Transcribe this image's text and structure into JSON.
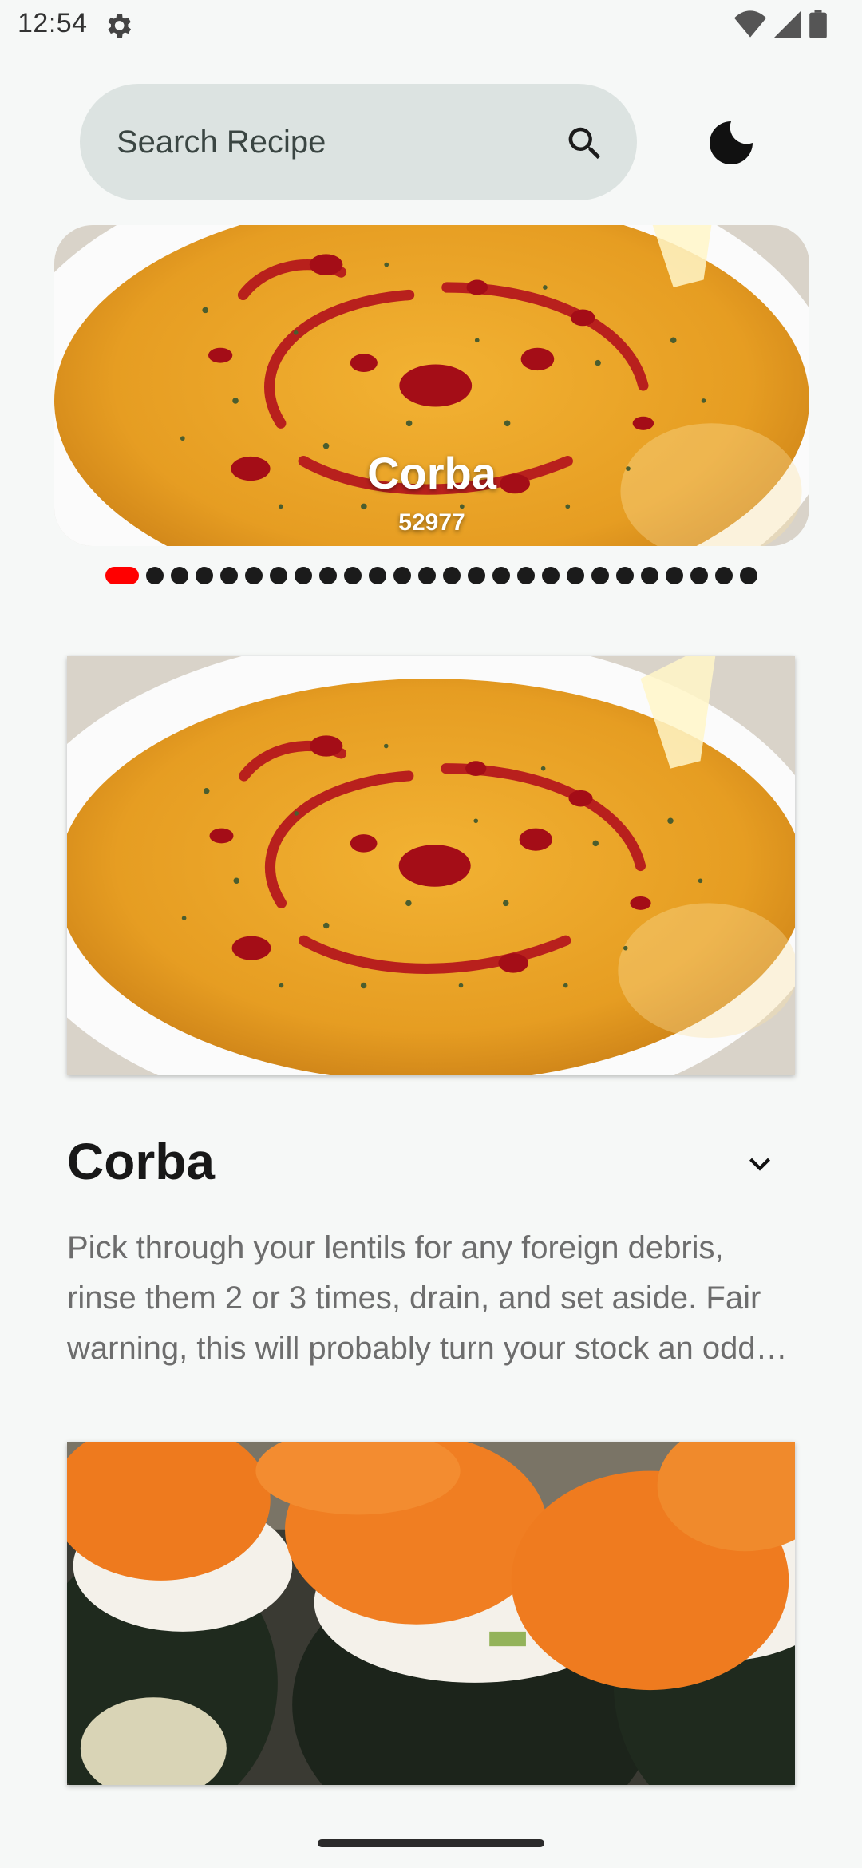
{
  "status": {
    "time": "12:54"
  },
  "search": {
    "placeholder": "Search Recipe"
  },
  "carousel": {
    "title": "Corba",
    "id": "52977",
    "dot_count": 26,
    "active_index": 0
  },
  "recipes": [
    {
      "title": "Corba",
      "description": "Pick through your lentils for any foreign debris, rinse them 2 or 3 times, drain, and set aside.  Fair warning, this will probably turn your stock an odd color."
    }
  ],
  "colors": {
    "background": "#f6f8f7",
    "search_bg": "#dce3e1",
    "dot_active": "#ff0000",
    "dot_inactive": "#1b1b1b"
  },
  "icons": {
    "settings": "gear-icon",
    "search": "search-icon",
    "theme": "moon-icon",
    "expand": "chevron-down-icon"
  }
}
